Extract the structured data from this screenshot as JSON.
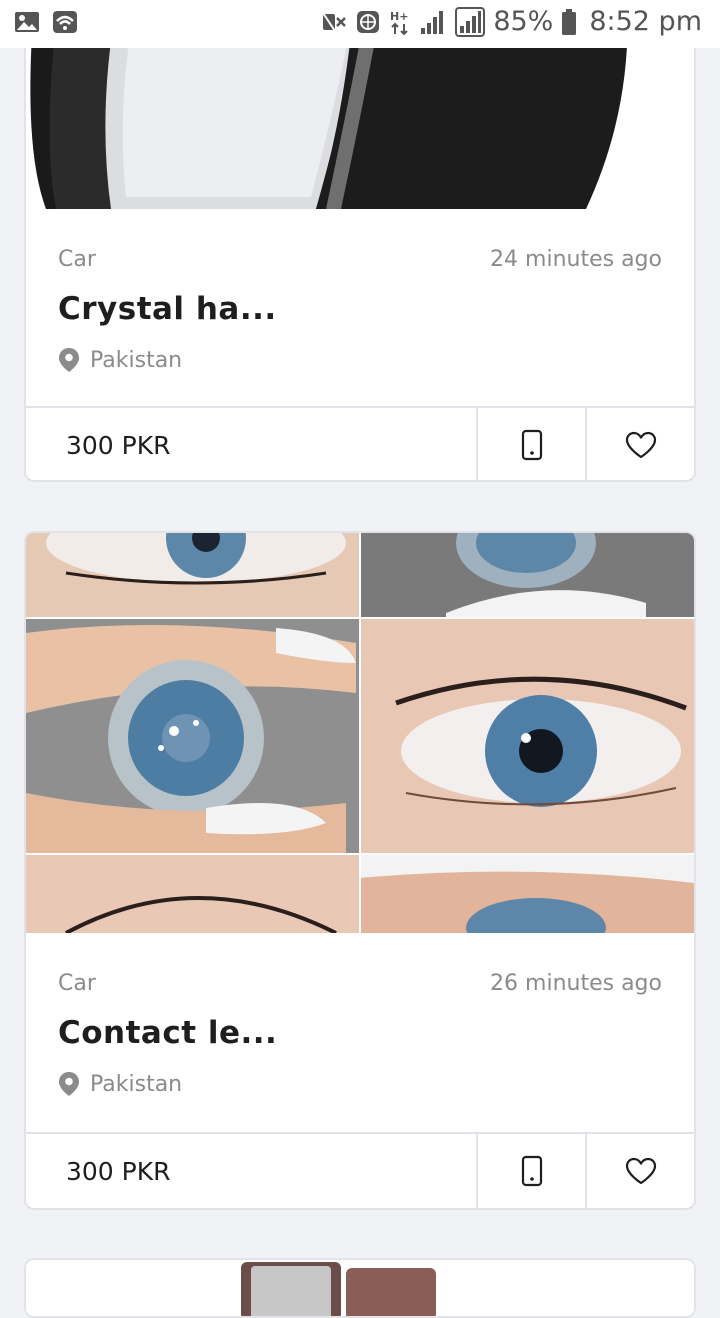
{
  "status_bar": {
    "battery_pct": "85%",
    "time": "8:52 pm",
    "icons": [
      "gallery-icon",
      "wifi-icon",
      "mute-icon",
      "vpn-icon",
      "network-h-plus-icon",
      "signal-icon",
      "signal-icon",
      "battery-icon"
    ]
  },
  "listings": [
    {
      "category": "Car",
      "time_ago": "24 minutes ago",
      "title": "Crystal ha...",
      "location": "Pakistan",
      "price": "300 PKR",
      "image": "black-white-case-photo"
    },
    {
      "category": "Car",
      "time_ago": "26 minutes ago",
      "title": "Contact le...",
      "location": "Pakistan",
      "price": "300 PKR",
      "image": "blue-contact-lens-collage"
    }
  ],
  "colors": {
    "background": "#f1f2f6",
    "card": "#ffffff",
    "border": "#e2e3e8",
    "muted_text": "#8b8b8b",
    "title_text": "#1e1e1e"
  }
}
